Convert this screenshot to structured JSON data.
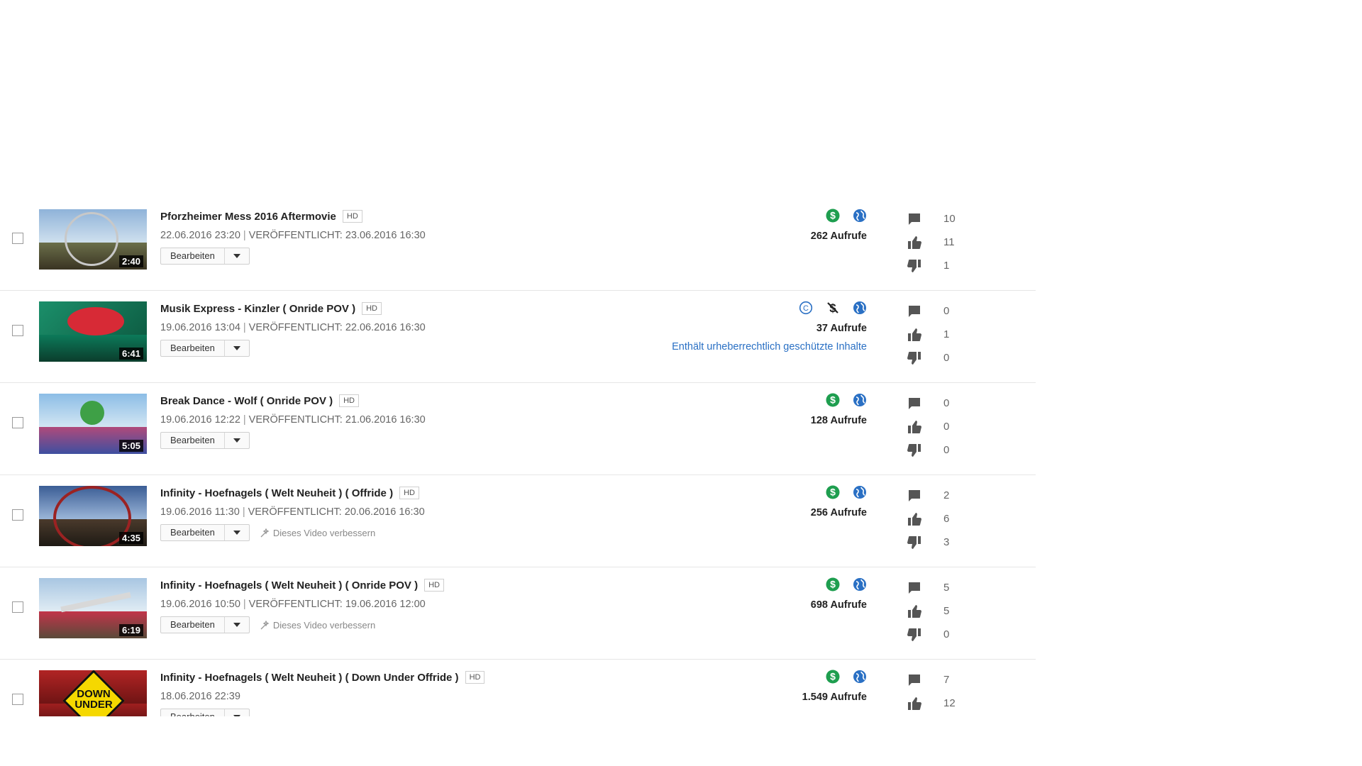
{
  "colors": {
    "monetized": "#1e9e4f",
    "public": "#2a70c4",
    "claim_link": "#2a70c4",
    "icon_gray": "#555555"
  },
  "edit_label": "Bearbeiten",
  "improve_label": "Dieses Video verbessern",
  "published_prefix": "VERÖFFENTLICHT:",
  "videos": [
    {
      "title": "Pforzheimer Mess 2016 Aftermovie",
      "badge": "HD",
      "duration": "2:40",
      "uploaded": "22.06.2016 23:20",
      "published": "23.06.2016 16:30",
      "views": "262 Aufrufe",
      "icons": [
        "dollar-icon",
        "globe-icon"
      ],
      "comments": "10",
      "likes": "11",
      "dislikes": "1",
      "improve": false,
      "claim": ""
    },
    {
      "title": "Musik Express - Kinzler ( Onride POV )",
      "badge": "HD",
      "duration": "6:41",
      "uploaded": "19.06.2016 13:04",
      "published": "22.06.2016 16:30",
      "views": "37 Aufrufe",
      "icons": [
        "copyright-icon",
        "no-dollar-icon",
        "globe-icon"
      ],
      "comments": "0",
      "likes": "1",
      "dislikes": "0",
      "improve": false,
      "claim": "Enthält urheberrechtlich geschützte Inhalte"
    },
    {
      "title": "Break Dance - Wolf ( Onride POV )",
      "badge": "HD",
      "duration": "5:05",
      "uploaded": "19.06.2016 12:22",
      "published": "21.06.2016 16:30",
      "views": "128 Aufrufe",
      "icons": [
        "dollar-icon",
        "globe-icon"
      ],
      "comments": "0",
      "likes": "0",
      "dislikes": "0",
      "improve": false,
      "claim": ""
    },
    {
      "title": "Infinity - Hoefnagels ( Welt Neuheit ) ( Offride )",
      "badge": "HD",
      "duration": "4:35",
      "uploaded": "19.06.2016 11:30",
      "published": "20.06.2016 16:30",
      "views": "256 Aufrufe",
      "icons": [
        "dollar-icon",
        "globe-icon"
      ],
      "comments": "2",
      "likes": "6",
      "dislikes": "3",
      "improve": true,
      "claim": ""
    },
    {
      "title": "Infinity - Hoefnagels ( Welt Neuheit ) ( Onride POV )",
      "badge": "HD",
      "duration": "6:19",
      "uploaded": "19.06.2016 10:50",
      "published": "19.06.2016 12:00",
      "views": "698 Aufrufe",
      "icons": [
        "dollar-icon",
        "globe-icon"
      ],
      "comments": "5",
      "likes": "5",
      "dislikes": "0",
      "improve": true,
      "claim": ""
    },
    {
      "title": "Infinity - Hoefnagels ( Welt Neuheit ) ( Down Under Offride )",
      "badge": "HD",
      "duration": "",
      "uploaded": "18.06.2016 22:39",
      "published": "",
      "views": "1.549 Aufrufe",
      "icons": [
        "dollar-icon",
        "globe-icon"
      ],
      "comments": "7",
      "likes": "12",
      "dislikes": "",
      "improve": false,
      "claim": "",
      "thumb_text": "DOWN UNDER"
    }
  ]
}
